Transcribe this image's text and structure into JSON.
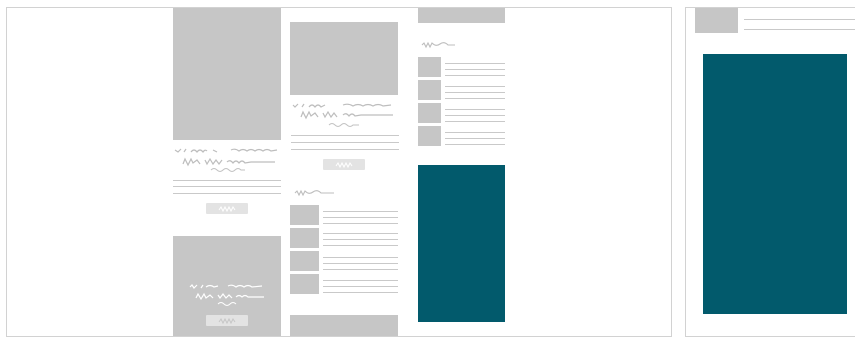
{
  "colors": {
    "frame_border": "#d2d2d2",
    "placeholder_block": "#c6c6c6",
    "placeholder_line": "#c9c9c9",
    "button_fill": "#e3e3e3",
    "accent_teal": "#025a6c",
    "scribble_stroke": "#bdbdbd",
    "button_scribble_stroke": "#ffffff"
  },
  "left_frame": {
    "columns": [
      {
        "cards": [
          "image-card",
          "image-overlay-card"
        ],
        "buttons": 2
      },
      {
        "cards": [
          "image-card",
          "list-section"
        ],
        "buttons": 1
      },
      {
        "cards": [
          "list-section",
          "teal-panel"
        ],
        "buttons": 0
      }
    ]
  },
  "right_frame": {
    "header_thumbnail": true,
    "teal_panel": true
  }
}
